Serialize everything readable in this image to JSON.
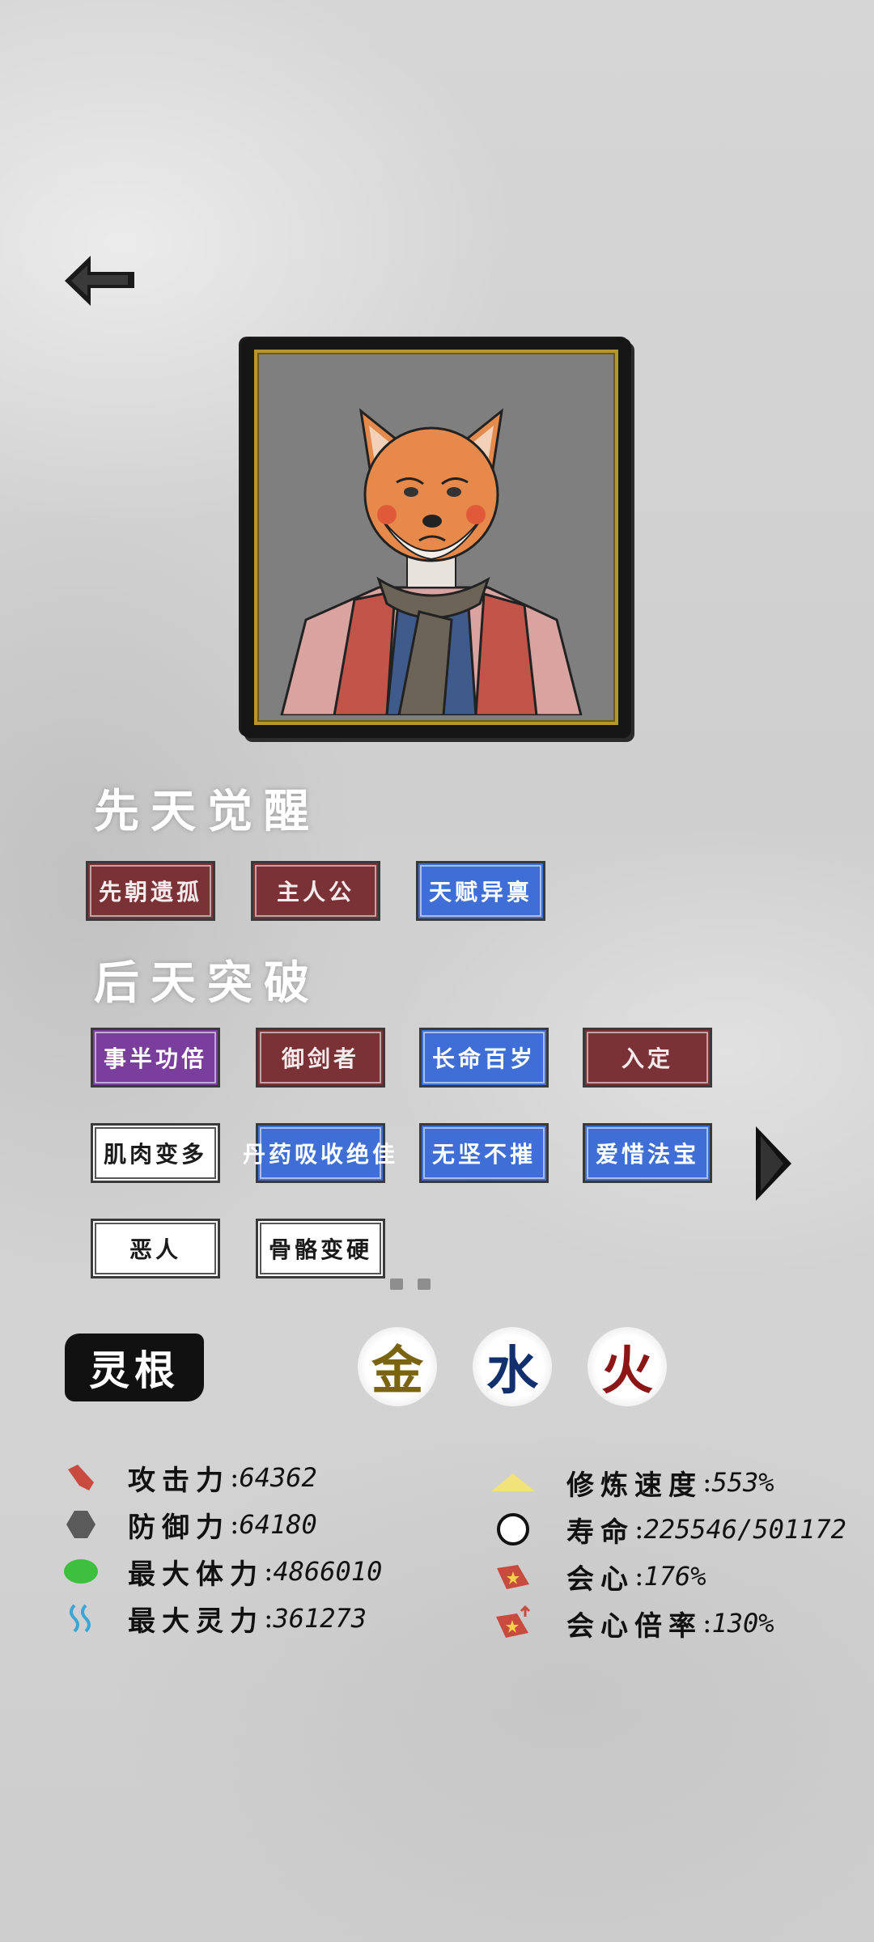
{
  "portrait_alt": "fox-masked character portrait",
  "sections": {
    "innate_title": "先天觉醒",
    "acquired_title": "后天突破"
  },
  "innate_talents": [
    {
      "label": "先朝遗孤",
      "style": "red"
    },
    {
      "label": "主人公",
      "style": "red"
    },
    {
      "label": "天赋异禀",
      "style": "blue"
    }
  ],
  "acquired_talents": [
    {
      "label": "事半功倍",
      "style": "purple"
    },
    {
      "label": "御剑者",
      "style": "red"
    },
    {
      "label": "长命百岁",
      "style": "blue"
    },
    {
      "label": "入定",
      "style": "red"
    },
    {
      "label": "肌肉变多",
      "style": "white"
    },
    {
      "label": "丹药吸收绝佳",
      "style": "blue"
    },
    {
      "label": "无坚不摧",
      "style": "blue"
    },
    {
      "label": "爱惜法宝",
      "style": "blue"
    },
    {
      "label": "恶人",
      "style": "white"
    },
    {
      "label": "骨骼变硬",
      "style": "white"
    }
  ],
  "pagination": {
    "pages": 2
  },
  "spirit_root": {
    "label": "灵根",
    "elements": [
      {
        "char": "金",
        "color": "#7a6410"
      },
      {
        "char": "水",
        "color": "#12306e"
      },
      {
        "char": "火",
        "color": "#8c1616"
      }
    ]
  },
  "stats_left": [
    {
      "icon": "attack-icon",
      "label": "攻击力",
      "value": "64362"
    },
    {
      "icon": "defense-icon",
      "label": "防御力",
      "value": "64180"
    },
    {
      "icon": "health-icon",
      "label": "最大体力",
      "value": "4866010"
    },
    {
      "icon": "spirit-icon",
      "label": "最大灵力",
      "value": "361273"
    }
  ],
  "stats_right": [
    {
      "icon": "cultivation-icon",
      "label": "修炼速度",
      "value": "553%"
    },
    {
      "icon": "lifespan-icon",
      "label": "寿命",
      "value": "225546/501172"
    },
    {
      "icon": "critical-icon",
      "label": "会心",
      "value": "176%"
    },
    {
      "icon": "critical-multiplier-icon",
      "label": "会心倍率",
      "value": "130%"
    }
  ],
  "colors": {
    "tag_red": "#7a3236",
    "tag_blue": "#3f6fd6",
    "tag_purple": "#7a3f9c",
    "tag_white": "#ffffff"
  }
}
